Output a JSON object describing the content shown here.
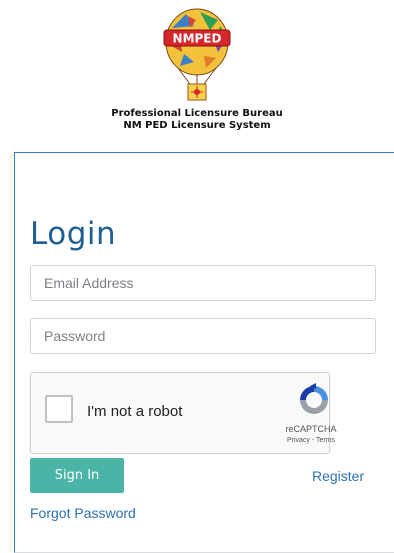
{
  "header": {
    "logo_text": "NMPED",
    "bureau_line1": "Professional Licensure Bureau",
    "bureau_line2": "NM PED Licensure System"
  },
  "login": {
    "title": "Login",
    "email_placeholder": "Email Address",
    "password_placeholder": "Password",
    "captcha": {
      "label": "I'm not a robot",
      "brand": "reCAPTCHA",
      "privacy": "Privacy",
      "separator": " - ",
      "terms": "Terms"
    },
    "signin_label": "Sign In",
    "register_label": "Register",
    "forgot_label": "Forgot Password"
  },
  "colors": {
    "title": "#1f5f93",
    "signin_button": "#4ab4a7",
    "link": "#2b72b5",
    "card_border": "#2e7ec0"
  }
}
